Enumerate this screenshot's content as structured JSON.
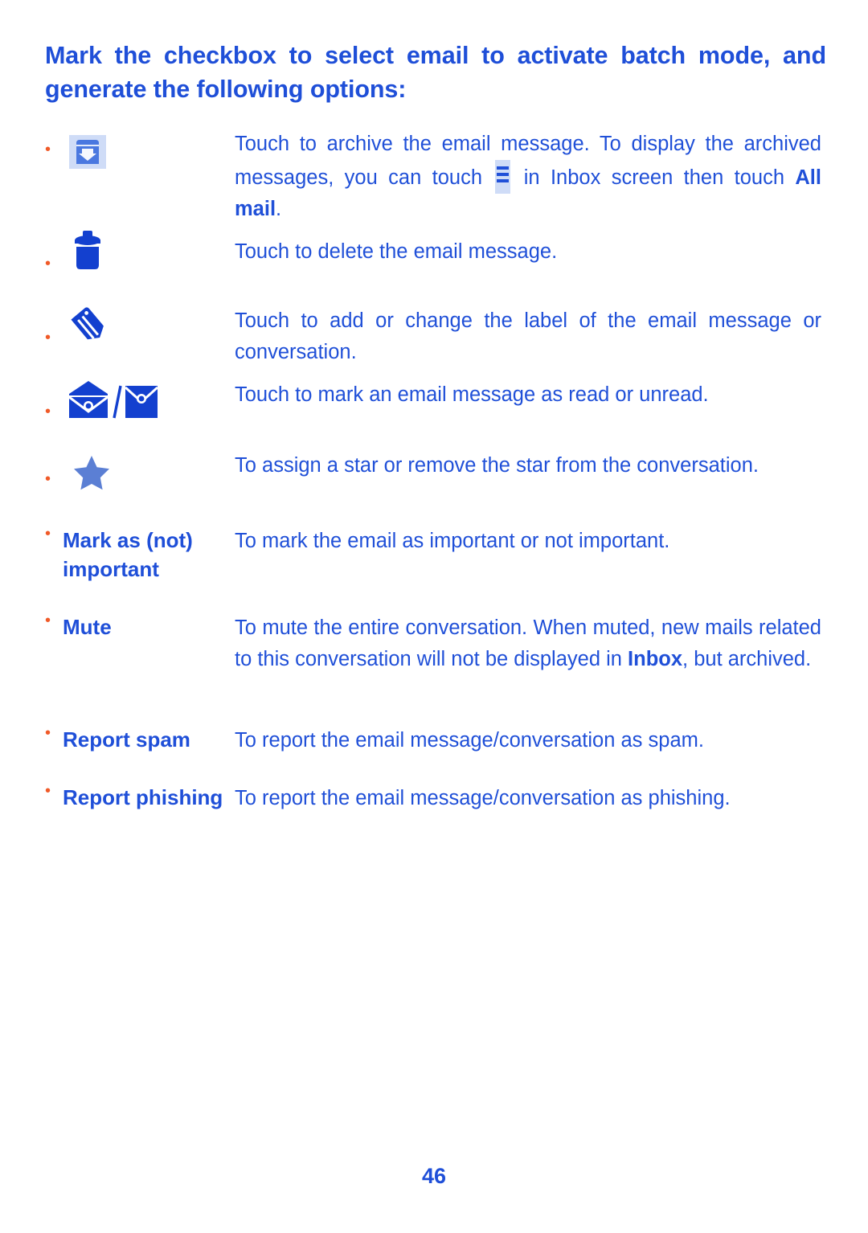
{
  "document": {
    "heading": "Mark the checkbox to select email to activate batch mode, and generate the following options:",
    "page_number": "46",
    "colors": {
      "text_blue": "#2050d8",
      "heading_blue": "#1f4fd8",
      "bullet_orange": "#f05a28",
      "icon_blue": "#1340cf",
      "icon_light_blue": "#cfdcf7",
      "star_blue": "#5b7fd4"
    }
  },
  "rows": [
    {
      "icon": "archive-icon",
      "label": "",
      "desc_before": "Touch to archive the email message. To display the archived messages, you can touch ",
      "inline_icon": "menu-icon",
      "desc_middle": " in Inbox screen then touch ",
      "desc_bold": "All mail",
      "desc_after": "."
    },
    {
      "icon": "trash-icon",
      "label": "",
      "desc": "Touch to delete the email message."
    },
    {
      "icon": "label-tag-icon",
      "label": "",
      "desc": "Touch to add or change the label of the email message or conversation."
    },
    {
      "icon": "envelope-read-unread-icon",
      "label": "",
      "desc": "Touch to mark an email message as read or unread."
    },
    {
      "icon": "star-icon",
      "label": "",
      "desc": "To assign a star or remove the star from the conversation."
    },
    {
      "icon": "",
      "label": "Mark as (not) important",
      "desc": "To mark the email as important or not important."
    },
    {
      "icon": "",
      "label": "Mute",
      "desc_before": "To mute the entire conversation. When muted, new mails related to this conversation will not be displayed in ",
      "desc_bold": "Inbox",
      "desc_after": ", but archived."
    },
    {
      "icon": "",
      "label": "Report spam",
      "desc": "To report the email message/conversation as spam."
    },
    {
      "icon": "",
      "label": "Report phishing",
      "desc": "To report the email message/conversation as phishing."
    }
  ]
}
